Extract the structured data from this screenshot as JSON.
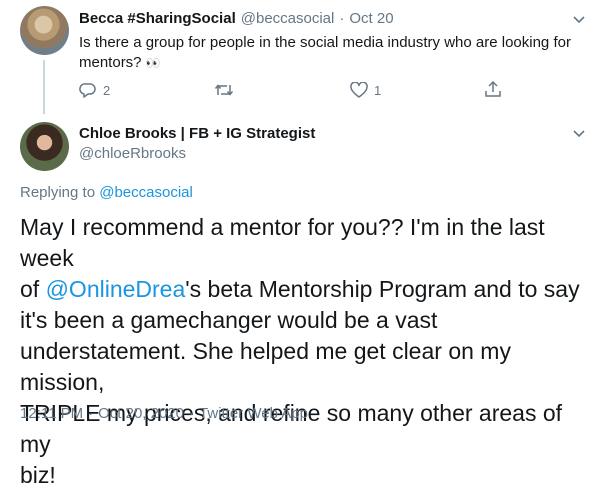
{
  "tweet1": {
    "name": "Becca #SharingSocial",
    "handle": "@beccasocial",
    "dot": "·",
    "date": "Oct 20",
    "text_line1": "Is there a group for people in the social media industry who are looking for",
    "text_line2": "mentors?",
    "emoji": "👀",
    "reply_count": "2",
    "like_count": "1"
  },
  "tweet2": {
    "name": "Chloe Brooks | FB + IG Strategist",
    "handle": "@chloeRbrooks",
    "replying_prefix": "Replying to ",
    "replying_handle": "@beccasocial",
    "body_line1": "May I recommend a mentor for you?? I'm in the last week",
    "body_line2_prefix": "of ",
    "body_mention": "@OnlineDrea",
    "body_line2_suffix": "'s beta Mentorship Program and to say",
    "body_line3": "it's been a gamechanger would be a vast",
    "body_line4": "understatement. She helped me get clear on my mission,",
    "body_line5": "TRIPLE my prices, and refine so many other areas of my",
    "body_line6": "biz!",
    "time": "12:11 PM",
    "dot": "·",
    "date": "Oct 20, 2020",
    "dot2": "·",
    "source": "Twitter Web App"
  },
  "colors": {
    "link": "#1b95e0",
    "muted": "#657786",
    "text": "#14171a"
  }
}
